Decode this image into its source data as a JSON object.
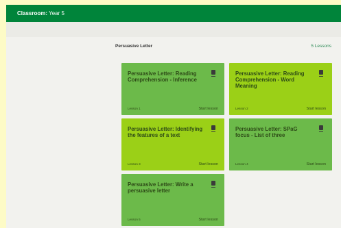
{
  "header": {
    "classroom_label": "Classroom:",
    "classroom_name": "Year 5",
    "bar_color": "#00843a"
  },
  "unit": {
    "title": "Persuasive Letter",
    "lesson_count": "5 Lessons"
  },
  "lessons": [
    {
      "title": "Persuasive Letter: Reading Comprehension - Inference",
      "number": "Lesson 1",
      "action": "Start lesson",
      "color": "#6cba4a"
    },
    {
      "title": "Persuasive Letter: Reading Comprehension - Word Meaning",
      "number": "Lesson 2",
      "action": "Start lesson",
      "color": "#9bd017"
    },
    {
      "title": "Persuasive Letter: Identifying the features of a text",
      "number": "Lesson 3",
      "action": "Start lesson",
      "color": "#9bd017"
    },
    {
      "title": "Persuasive Letter: SPaG focus - List of three",
      "number": "Lesson 4",
      "action": "Start lesson",
      "color": "#6cba4a"
    },
    {
      "title": "Persuasive Letter: Write a persuasive letter",
      "number": "Lesson 5",
      "action": "Start lesson",
      "color": "#6cba4a"
    }
  ],
  "icons": {
    "lesson_card": "document-icon"
  }
}
